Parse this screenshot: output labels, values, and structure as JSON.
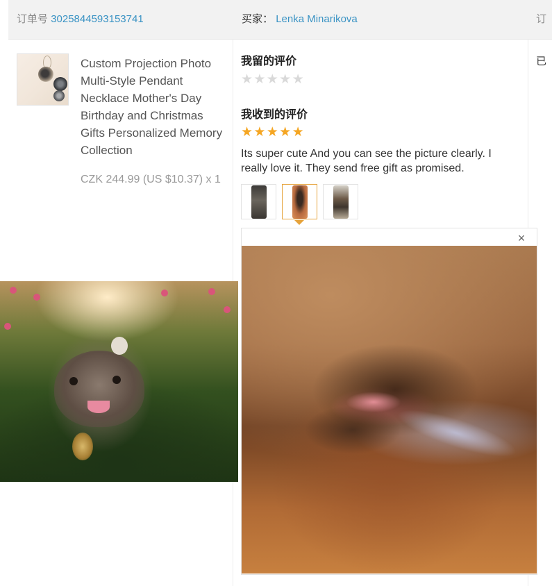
{
  "header": {
    "order_label": "订单号",
    "order_number": "3025844593153741",
    "buyer_label": "买家：",
    "buyer_name": "Lenka Minarikova",
    "right_label_cut": "订"
  },
  "product": {
    "image_icon": "necklace-thumbnail",
    "title": "Custom Projection Photo Multi-Style Pendant Necklace Mother's Day Birthday and Christmas Gifts Personalized Memory Collection",
    "price": "CZK 244.99 (US $10.37) x 1"
  },
  "my_review": {
    "title": "我留的评价",
    "rating": 0,
    "max_rating": 5
  },
  "received_review": {
    "title": "我收到的评价",
    "rating": 5,
    "max_rating": 5,
    "text": "Its super cute And you can see the picture clearly. I really love it. They send free gift as promised.",
    "thumbnails": [
      {
        "name": "review-photo-1"
      },
      {
        "name": "review-photo-2",
        "selected": true
      },
      {
        "name": "review-photo-3"
      }
    ]
  },
  "viewer": {
    "close_icon": "close-icon",
    "close_glyph": "×"
  },
  "status_cut": "已",
  "colors": {
    "link": "#3a93c4",
    "star_active": "#f5a623",
    "star_inactive": "#d9d9d9",
    "thumb_selected_border": "#e6a33c"
  }
}
